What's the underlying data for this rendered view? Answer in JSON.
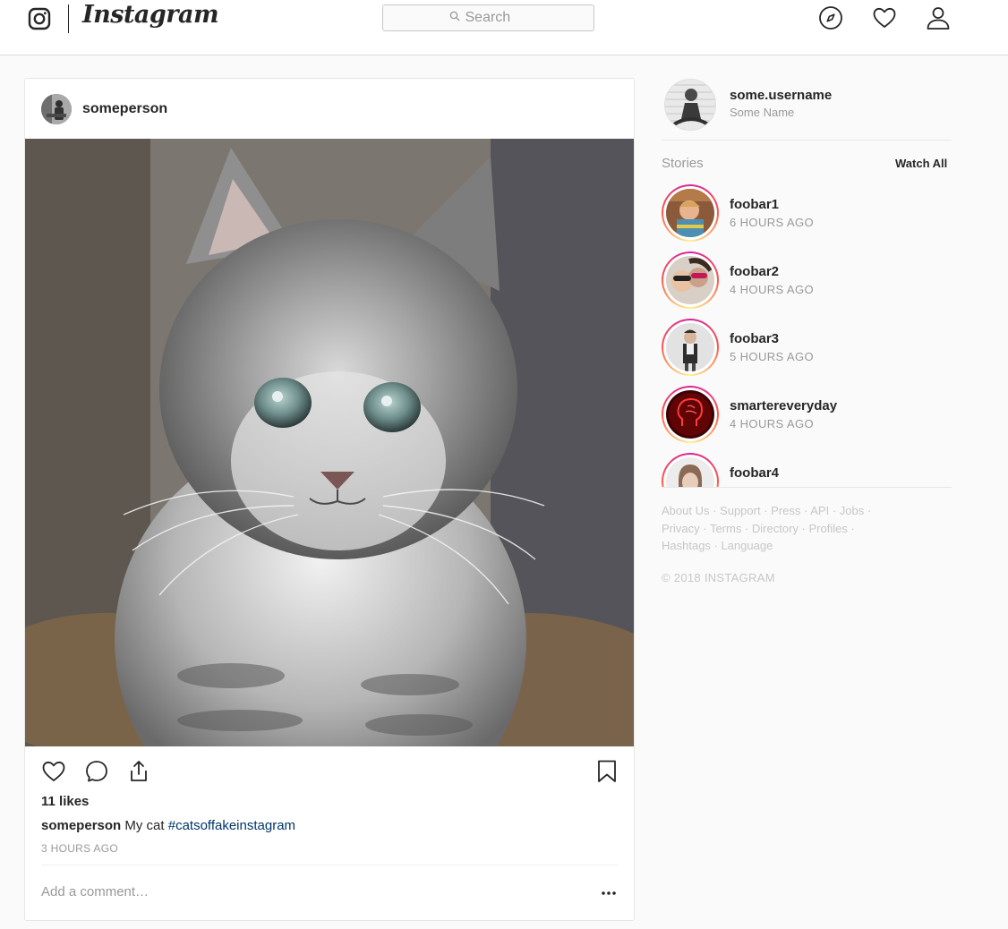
{
  "nav": {
    "brand": "Instagram",
    "search_placeholder": "Search"
  },
  "post": {
    "username": "someperson",
    "likes": "11 likes",
    "caption_user": "someperson",
    "caption_text": "My cat",
    "caption_hashtag": "#catsoffakeinstagram",
    "time": "3 HOURS AGO",
    "comment_placeholder": "Add a comment…",
    "more_label": "•••"
  },
  "sidebar": {
    "username": "some.username",
    "name": "Some Name",
    "stories_title": "Stories",
    "watch_all": "Watch All",
    "stories": [
      {
        "name": "foobar1",
        "time": "6 HOURS AGO"
      },
      {
        "name": "foobar2",
        "time": "4 HOURS AGO"
      },
      {
        "name": "foobar3",
        "time": "5 HOURS AGO"
      },
      {
        "name": "smartereveryday",
        "time": "4 HOURS AGO"
      },
      {
        "name": "foobar4",
        "time": ""
      }
    ],
    "footer_links": [
      "About Us",
      "Support",
      "Press",
      "API",
      "Jobs",
      "Privacy",
      "Terms",
      "Directory",
      "Profiles",
      "Hashtags",
      "Language"
    ],
    "copyright": "© 2018 INSTAGRAM"
  },
  "colors": {
    "text": "#262626",
    "muted": "#999999",
    "hashtag": "#003569",
    "border": "#dbdbdb",
    "background": "#fafafa"
  },
  "icons": [
    "instagram-logo-icon",
    "search-icon",
    "explore-compass-icon",
    "activity-heart-icon",
    "profile-person-icon",
    "like-heart-icon",
    "comment-bubble-icon",
    "share-icon",
    "bookmark-icon"
  ]
}
